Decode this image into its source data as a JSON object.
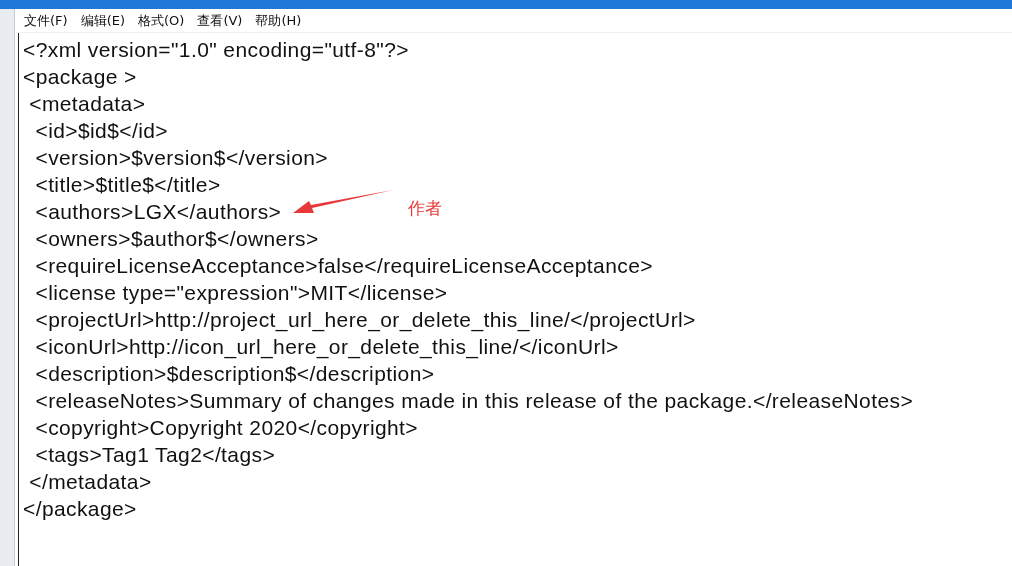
{
  "menu": [
    {
      "label": "文件(F)"
    },
    {
      "label": "编辑(E)"
    },
    {
      "label": "格式(O)"
    },
    {
      "label": "查看(V)"
    },
    {
      "label": "帮助(H)"
    }
  ],
  "editor": {
    "lines": [
      "<?xml version=\"1.0\" encoding=\"utf-8\"?>",
      "<package >",
      " <metadata>",
      "  <id>$id$</id>",
      "  <version>$version$</version>",
      "  <title>$title$</title>",
      "  <authors>LGX</authors>",
      "  <owners>$author$</owners>",
      "  <requireLicenseAcceptance>false</requireLicenseAcceptance>",
      "  <license type=\"expression\">MIT</license>",
      "  <projectUrl>http://project_url_here_or_delete_this_line/</projectUrl>",
      "  <iconUrl>http://icon_url_here_or_delete_this_line/</iconUrl>",
      "  <description>$description$</description>",
      "  <releaseNotes>Summary of changes made in this release of the package.</releaseNotes>",
      "  <copyright>Copyright 2020</copyright>",
      "  <tags>Tag1 Tag2</tags>",
      " </metadata>",
      "</package>"
    ]
  },
  "annotation": {
    "label": "作者",
    "color": "#e8393a"
  }
}
